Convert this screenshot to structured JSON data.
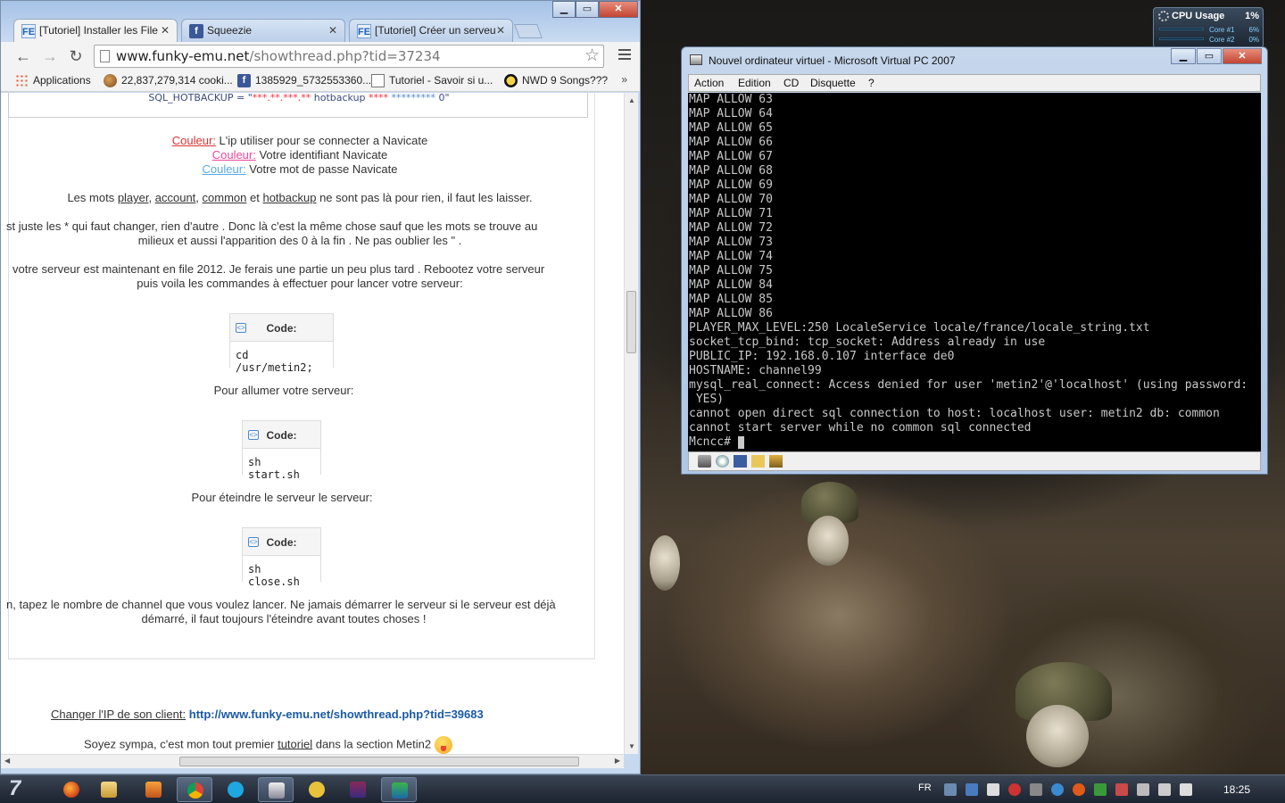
{
  "browser": {
    "tabs": [
      {
        "label": "[Tutoriel] Installer les File",
        "favicon": "FE"
      },
      {
        "label": "Squeezie",
        "favicon": "f"
      },
      {
        "label": "[Tutoriel] Créer un serveu",
        "favicon": "FE"
      }
    ],
    "url_host": "www.funky-emu.net",
    "url_path": "/showthread.php?tid=37234",
    "bookmarks": [
      {
        "label": "Applications"
      },
      {
        "label": "22,837,279,314 cooki..."
      },
      {
        "label": "1385929_5732553360..."
      },
      {
        "label": "Tutoriel - Savoir si u..."
      },
      {
        "label": "NWD 9 Songs???"
      }
    ],
    "bookmarks_more": "»"
  },
  "page": {
    "sql_prefix": "SQL_HOTBACKUP = \"",
    "sql_mask1": "***.**.***.**",
    "sql_mid": " hotbackup ",
    "sql_mask2": "****",
    "sql_mask3": " *********",
    "sql_suffix": " 0\"",
    "colors": [
      {
        "label": "Couleur:",
        "text": " L'ip utiliser pour se connecter a Navicate"
      },
      {
        "label": "Couleur:",
        "text": " Votre identifiant Navicate"
      },
      {
        "label": "Couleur:",
        "text": " Votre mot de passe Navicate"
      }
    ],
    "words_line": {
      "p1": "Les mots ",
      "w1": "player",
      "s1": ", ",
      "w2": "account",
      "s2": ", ",
      "w3": "common",
      "p2": " et ",
      "w4": "hotbackup",
      "p3": " ne sont pas là pour rien, il faut les laisser."
    },
    "para1_l1": "st juste les * qui faut changer, rien d'autre . Donc là c'est la même chose sauf que les mots se trouve au",
    "para1_l2": "milieux et aussi l'apparition des 0 à la fin . Ne pas oublier les \" .",
    "para2_l1": "votre serveur est maintenant en file 2012. Je ferais une partie un peu plus tard . Rebootez votre serveur",
    "para2_l2": "puis voila les commandes à effectuer pour lancer votre serveur:",
    "code_label": "Code:",
    "code1": "cd /usr/metin2;",
    "start_title": "Pour allumer votre serveur:",
    "code2": "sh start.sh",
    "stop_title": "Pour éteindre le serveur le serveur:",
    "code3": "sh close.sh",
    "para3_l1": "n, tapez le nombre de channel que vous voulez lancer. Ne jamais démarrer le serveur si le serveur est déjà",
    "para3_l2": "démarré, il faut toujours l'éteindre avant toutes choses !",
    "ip_label": "Changer l'IP de son client:",
    "ip_link": "http://www.funky-emu.net/showthread.php?tid=39683",
    "footer_p1": "Soyez sympa, c'est mon tout premier ",
    "footer_word": "tutoriel",
    "footer_p2": " dans la section Metin2 "
  },
  "vpc": {
    "title": "Nouvel ordinateur virtuel - Microsoft Virtual PC 2007",
    "menu": [
      "Action",
      "Edition",
      "CD",
      "Disquette",
      "?"
    ],
    "terminal_lines": [
      "MAP ALLOW 63",
      "MAP ALLOW 64",
      "MAP ALLOW 65",
      "MAP ALLOW 66",
      "MAP ALLOW 67",
      "MAP ALLOW 68",
      "MAP ALLOW 69",
      "MAP ALLOW 70",
      "MAP ALLOW 71",
      "MAP ALLOW 72",
      "MAP ALLOW 73",
      "MAP ALLOW 74",
      "MAP ALLOW 75",
      "MAP ALLOW 84",
      "MAP ALLOW 85",
      "MAP ALLOW 86",
      "PLAYER_MAX_LEVEL:250 LocaleService locale/france/locale_string.txt",
      "socket_tcp_bind: tcp_socket: Address already in use",
      "PUBLIC_IP: 192.168.0.107 interface de0",
      "HOSTNAME: channel99",
      "mysql_real_connect: Access denied for user 'metin2'@'localhost' (using password:",
      " YES)",
      "cannot open direct sql connection to host: localhost user: metin2 db: common",
      "cannot start server while no common sql connected"
    ],
    "prompt": "Mcncc# "
  },
  "gadget": {
    "title": "CPU Usage",
    "total": "1%",
    "cores": [
      {
        "label": "Core #1",
        "value": "6%"
      },
      {
        "label": "Core #2",
        "value": "0%"
      }
    ]
  },
  "taskbar": {
    "lang": "FR",
    "time": "18:25"
  }
}
